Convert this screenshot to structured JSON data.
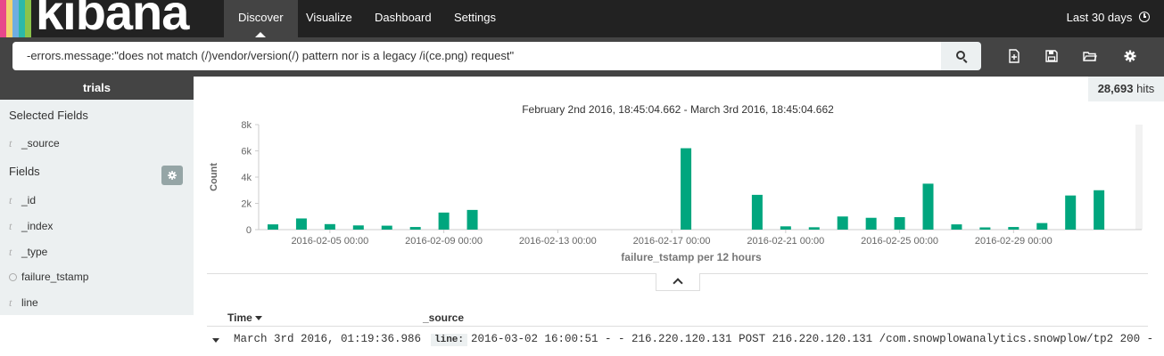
{
  "nav": {
    "logo_text": "kibana",
    "tabs": [
      {
        "label": "Discover",
        "active": true
      },
      {
        "label": "Visualize",
        "active": false
      },
      {
        "label": "Dashboard",
        "active": false
      },
      {
        "label": "Settings",
        "active": false
      }
    ],
    "timepicker": "Last 30 days"
  },
  "search": {
    "query": "-errors.message:\"does not match (/)vendor/version(/) pattern nor is a legacy /i(ce.png) request\""
  },
  "toolbar": {
    "icons": [
      "new-search-icon",
      "save-icon",
      "open-icon",
      "gear-icon"
    ]
  },
  "sidebar": {
    "index_pattern": "trials",
    "selected_fields_title": "Selected Fields",
    "selected_fields": [
      {
        "type": "t",
        "name": "_source"
      }
    ],
    "fields_title": "Fields",
    "fields": [
      {
        "type": "t",
        "name": "_id"
      },
      {
        "type": "t",
        "name": "_index"
      },
      {
        "type": "t",
        "name": "_type"
      },
      {
        "type": "clock",
        "name": "failure_tstamp"
      },
      {
        "type": "t",
        "name": "line"
      }
    ]
  },
  "hits": {
    "count": "28,693",
    "label": "hits"
  },
  "date_range": "February 2nd 2016, 18:45:04.662 - March 3rd 2016, 18:45:04.662",
  "chart_data": {
    "type": "bar",
    "title": "February 2nd 2016, 18:45:04.662 - March 3rd 2016, 18:45:04.662",
    "xlabel": "failure_tstamp per 12 hours",
    "ylabel": "Count",
    "ylim": [
      0,
      8000
    ],
    "y_ticks": [
      "0",
      "2k",
      "4k",
      "6k",
      "8k"
    ],
    "x_tick_labels": [
      "2016-02-05 00:00",
      "2016-02-09 00:00",
      "2016-02-13 00:00",
      "2016-02-17 00:00",
      "2016-02-21 00:00",
      "2016-02-25 00:00",
      "2016-02-29 00:00"
    ],
    "x_start": "2016-02-03 00:00",
    "interval_hours": 12,
    "bars": [
      {
        "slot": 0,
        "value": 400
      },
      {
        "slot": 2,
        "value": 850
      },
      {
        "slot": 4,
        "value": 420
      },
      {
        "slot": 6,
        "value": 320
      },
      {
        "slot": 8,
        "value": 300
      },
      {
        "slot": 10,
        "value": 200
      },
      {
        "slot": 12,
        "value": 1300
      },
      {
        "slot": 14,
        "value": 1500
      },
      {
        "slot": 29,
        "value": 6200
      },
      {
        "slot": 34,
        "value": 2650
      },
      {
        "slot": 36,
        "value": 250
      },
      {
        "slot": 38,
        "value": 180
      },
      {
        "slot": 40,
        "value": 1000
      },
      {
        "slot": 42,
        "value": 900
      },
      {
        "slot": 44,
        "value": 950
      },
      {
        "slot": 46,
        "value": 3500
      },
      {
        "slot": 48,
        "value": 400
      },
      {
        "slot": 50,
        "value": 170
      },
      {
        "slot": 52,
        "value": 200
      },
      {
        "slot": 54,
        "value": 500
      },
      {
        "slot": 56,
        "value": 2600
      },
      {
        "slot": 58,
        "value": 3000
      }
    ],
    "bar_color": "#00a67e",
    "grid": false
  },
  "table": {
    "columns": [
      "Time",
      "_source"
    ],
    "rows": [
      {
        "time": "March 3rd 2016, 01:19:36.986",
        "source_key": "line:",
        "source_value": "2016-03-02 16:00:51 - - 216.220.120.131 POST 216.220.120.131 /com.snowplowanalytics.snowplow/tp2 200 -"
      }
    ]
  },
  "colors": {
    "nav_bg": "#222222",
    "search_bg": "#444444",
    "sidebar_bg": "#ecf0f1",
    "accent": "#00a67e"
  }
}
